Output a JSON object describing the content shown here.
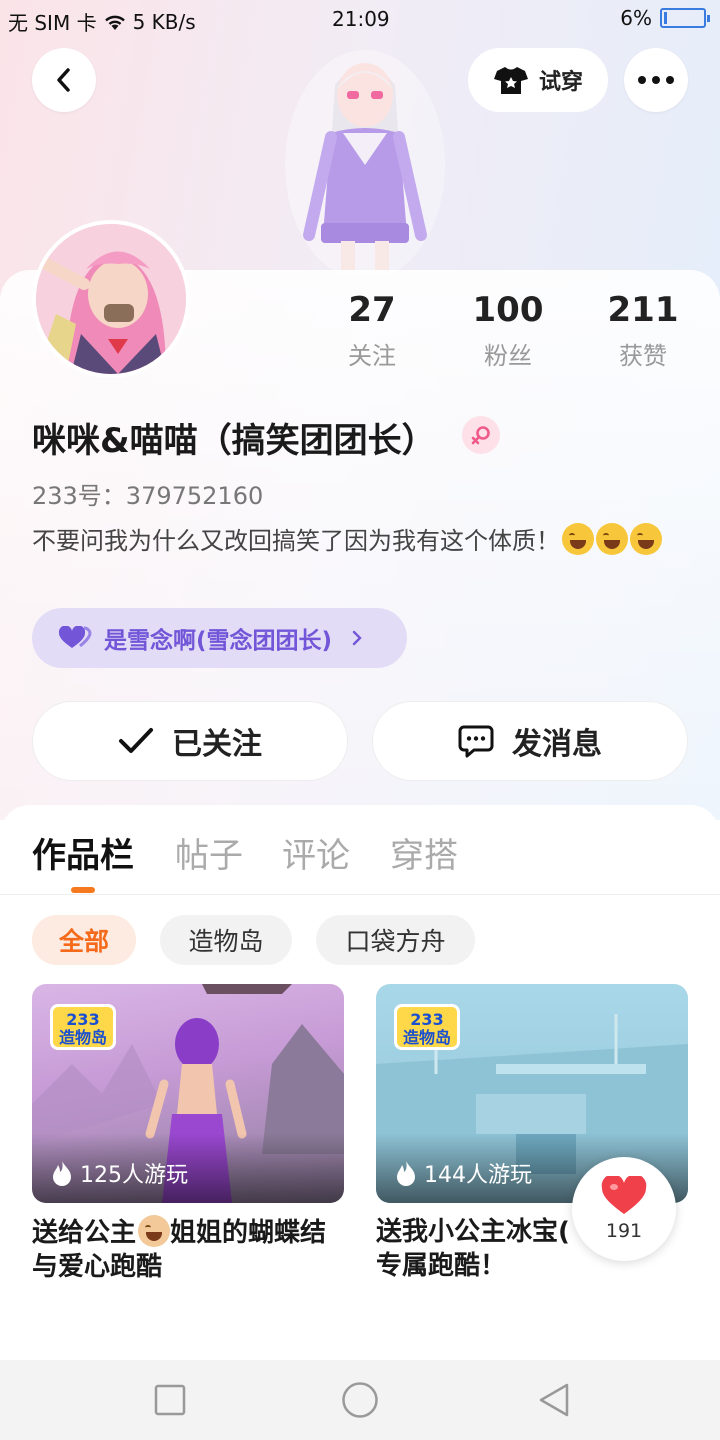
{
  "status_bar": {
    "carrier": "无 SIM 卡",
    "speed": "5 KB/s",
    "time": "21:09",
    "battery": "6%"
  },
  "header": {
    "tryon_label": "试穿"
  },
  "stats": [
    {
      "value": "27",
      "label": "关注"
    },
    {
      "value": "100",
      "label": "粉丝"
    },
    {
      "value": "211",
      "label": "获赞"
    }
  ],
  "profile": {
    "name": "咪咪&喵喵（搞笑团团长）",
    "uid": "233号：379752160",
    "bio": "不要问我为什么又改回搞笑了因为我有这个体质！",
    "family_label": "是雪念啊(雪念团团长)"
  },
  "actions": {
    "follow_label": "已关注",
    "message_label": "发消息"
  },
  "tabs": [
    "作品栏",
    "帖子",
    "评论",
    "穿搭"
  ],
  "filters": [
    "全部",
    "造物岛",
    "口袋方舟"
  ],
  "works": [
    {
      "logo_line1": "233",
      "logo_line2": "造物岛",
      "plays": "125人游玩",
      "title_part1": "送给公主",
      "title_part2": "姐姐的蝴蝶结与爱心跑酷"
    },
    {
      "logo_line1": "233",
      "logo_line2": "造物岛",
      "plays": "144人游玩",
      "title_part1": "送我小公主冰宝(",
      "title_part2": "专属跑酷！"
    }
  ],
  "like_count": "191",
  "colors": {
    "accent": "#f57a1f",
    "family_text": "#7356d8",
    "family_bg": "#e2dcf7",
    "like": "#f0404a"
  },
  "icons": [
    "back-icon",
    "tshirt-icon",
    "more-icon",
    "female-icon",
    "heart-icon",
    "chevron-right-icon",
    "check-icon",
    "chat-icon",
    "flame-icon",
    "like-heart-icon",
    "home-square-icon",
    "home-circle-icon",
    "back-triangle-icon"
  ]
}
